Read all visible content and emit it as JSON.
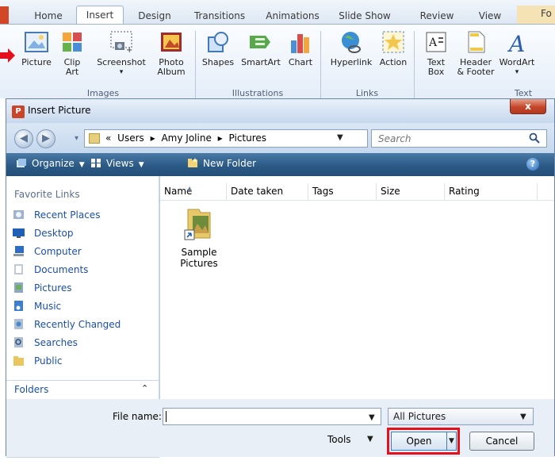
{
  "ribbon": {
    "tabs": [
      "Home",
      "Insert",
      "Design",
      "Transitions",
      "Animations",
      "Slide Show",
      "Review",
      "View",
      "Fo"
    ],
    "active_tab": "Insert",
    "buttons": {
      "picture": "Picture",
      "clip_art": "Clip Art",
      "screenshot": "Screenshot",
      "photo_album": "Photo Album",
      "shapes": "Shapes",
      "smartart": "SmartArt",
      "chart": "Chart",
      "hyperlink": "Hyperlink",
      "action": "Action",
      "text_box": "Text Box",
      "header_footer": "Header & Footer",
      "wordart": "WordArt"
    },
    "groups": {
      "images": "Images",
      "illustrations": "Illustrations",
      "links": "Links",
      "text": "Text"
    }
  },
  "dialog": {
    "title": "Insert Picture",
    "close_glyph": "x",
    "address": {
      "overflow": "«",
      "segments": [
        "Users",
        "Amy Joline",
        "Pictures"
      ],
      "separator": "▸"
    },
    "search_placeholder": "Search",
    "toolbar": {
      "organize": "Organize",
      "views": "Views",
      "new_folder": "New Folder",
      "help": "?"
    },
    "favorites": {
      "heading": "Favorite Links",
      "items": [
        "Recent Places",
        "Desktop",
        "Computer",
        "Documents",
        "Pictures",
        "Music",
        "Recently Changed",
        "Searches",
        "Public"
      ]
    },
    "folders_label": "Folders",
    "columns": [
      "Name",
      "Date taken",
      "Tags",
      "Size",
      "Rating"
    ],
    "files": [
      {
        "name": "Sample Pictures"
      }
    ],
    "file_name_label": "File name:",
    "file_name_value": "",
    "file_type": "All Pictures",
    "tools_label": "Tools",
    "open_label": "Open",
    "cancel_label": "Cancel"
  },
  "accent": {
    "highlight": "#e5101b",
    "toolbar_blue": "#2b5a86",
    "link_blue": "#1b4fa7"
  }
}
